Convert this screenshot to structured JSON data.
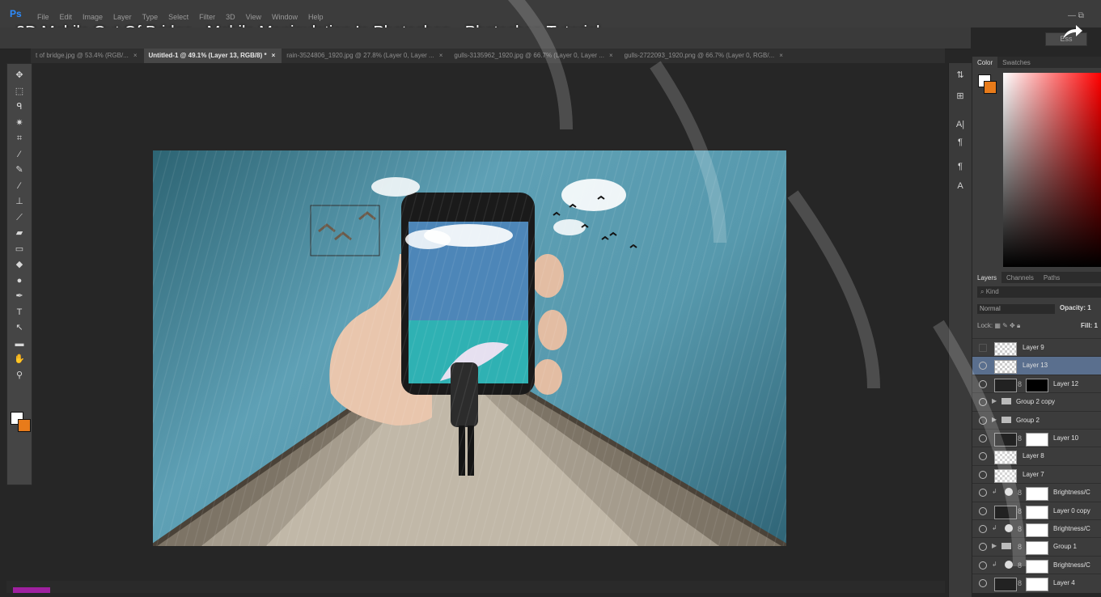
{
  "app": {
    "logo": "Ps",
    "menu": [
      "File",
      "Edit",
      "Image",
      "Layer",
      "Type",
      "Select",
      "Filter",
      "3D",
      "View",
      "Window",
      "Help"
    ],
    "video_title": "3D Mobile Out Of Bridge - Mobile Manipulation In Photoshop - Photoshop Tutorial",
    "essentials": "Ess"
  },
  "tabs": [
    {
      "label": "t of bridge.jpg @ 53.4% (RGB/...",
      "active": false
    },
    {
      "label": "Untitled-1 @ 49.1% (Layer 13, RGB/8) *",
      "active": true
    },
    {
      "label": "rain-3524806_1920.jpg @ 27.8% (Layer 0, Layer ...",
      "active": false
    },
    {
      "label": "gulls-3135962_1920.jpg @ 66.7% (Layer 0, Layer ...",
      "active": false
    },
    {
      "label": "gulls-2722093_1920.png @ 66.7% (Layer 0, RGB/...",
      "active": false
    }
  ],
  "tools": [
    "move-tool",
    "marquee-tool",
    "lasso-tool",
    "magic-wand-tool",
    "crop-tool",
    "eyedropper-tool",
    "healing-brush-tool",
    "brush-tool",
    "clone-stamp-tool",
    "history-brush-tool",
    "eraser-tool",
    "gradient-tool",
    "blur-tool",
    "dodge-tool",
    "pen-tool",
    "type-tool",
    "path-selection-tool",
    "shape-tool",
    "hand-tool",
    "zoom-tool"
  ],
  "colors": {
    "foreground": "#ffffff",
    "background": "#e87b1a",
    "selected_layer": "#5a6f8e"
  },
  "color_panel": {
    "tabs": [
      "Color",
      "Swatches"
    ]
  },
  "layers_panel": {
    "tabs": [
      "Layers",
      "Channels",
      "Paths"
    ],
    "kind": "Kind",
    "blend_mode": "Normal",
    "opacity_label": "Opacity:",
    "opacity_value": "1",
    "lock_label": "Lock:",
    "fill_label": "Fill:",
    "fill_value": "1",
    "layers": [
      {
        "name": "Layer 9",
        "visible": false,
        "type": "pixel"
      },
      {
        "name": "Layer 13",
        "visible": true,
        "type": "pixel",
        "selected": true
      },
      {
        "name": "Layer 12",
        "visible": true,
        "type": "masked"
      },
      {
        "name": "Group 2 copy",
        "visible": true,
        "type": "group"
      },
      {
        "name": "Group 2",
        "visible": true,
        "type": "group"
      },
      {
        "name": "Layer 10",
        "visible": true,
        "type": "masked"
      },
      {
        "name": "Layer 8",
        "visible": true,
        "type": "pixel"
      },
      {
        "name": "Layer 7",
        "visible": true,
        "type": "pixel"
      },
      {
        "name": "Brightness/C",
        "visible": true,
        "type": "adjustment"
      },
      {
        "name": "Layer 0 copy",
        "visible": true,
        "type": "masked"
      },
      {
        "name": "Brightness/C",
        "visible": true,
        "type": "adjustment"
      },
      {
        "name": "Group 1",
        "visible": true,
        "type": "group-masked"
      },
      {
        "name": "Brightness/C",
        "visible": true,
        "type": "adjustment"
      },
      {
        "name": "Layer 4",
        "visible": true,
        "type": "masked"
      }
    ]
  }
}
